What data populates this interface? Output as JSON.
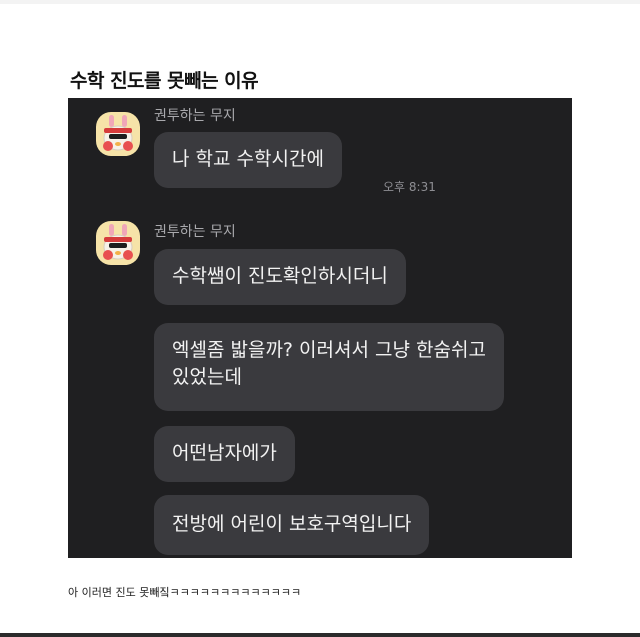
{
  "post": {
    "title": "수학 진도를 못빼는 이유",
    "caption": "아 이러면 진도 못빼짘ㅋㅋㅋㅋㅋㅋㅋㅋㅋㅋㅋㅋㅋ"
  },
  "chat": {
    "groups": [
      {
        "sender": "권투하는 무지",
        "messages": [
          {
            "text": "나 학교 수학시간에",
            "time": "오후 8:31"
          }
        ]
      },
      {
        "sender": "권투하는 무지",
        "messages": [
          {
            "text": "수학쌤이 진도확인하시더니"
          },
          {
            "line1": "엑셀좀 밟을까? 이러셔서 그냥 한숨쉬고",
            "line2": "있었는데"
          },
          {
            "text": "어떤남자에가"
          },
          {
            "text": "전방에 어린이 보호구역입니다"
          }
        ]
      }
    ]
  },
  "colors": {
    "chat_background": "#1f1f21",
    "bubble": "#3a3a3e",
    "bubble_text": "#f2f2f2",
    "sender_text": "#a9a9ad",
    "avatar_background": "#f6e3a8"
  },
  "icons": {
    "avatar": "muzi-boxing-avatar-icon"
  }
}
